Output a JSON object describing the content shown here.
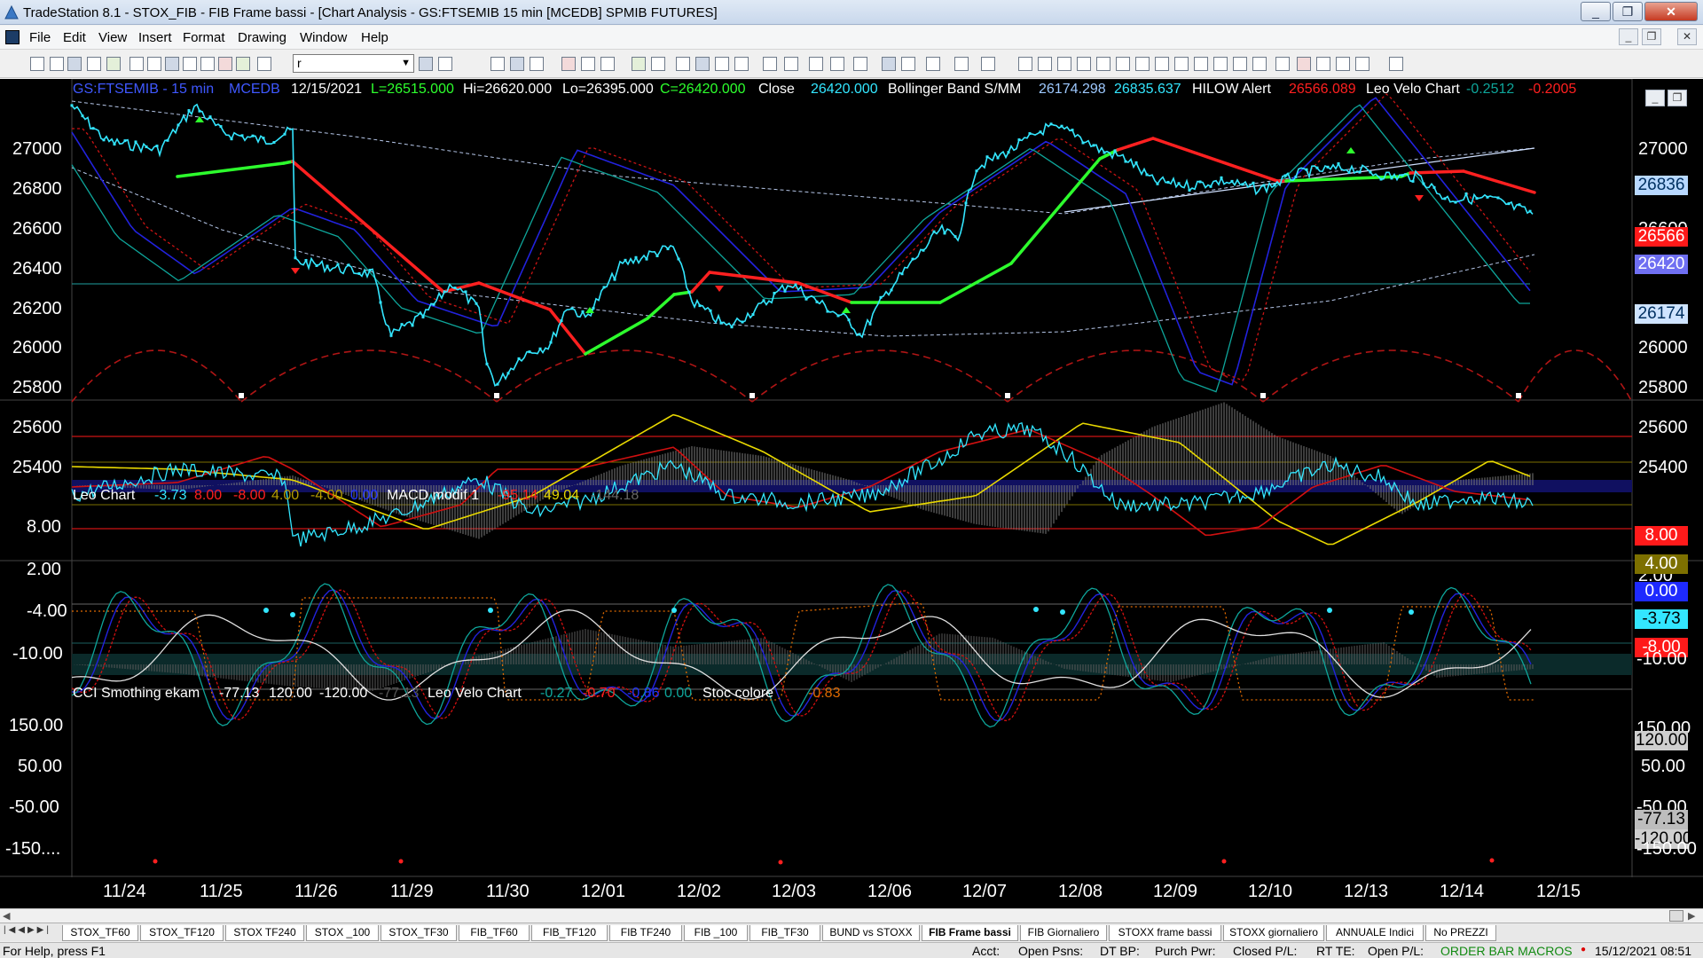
{
  "window": {
    "title": "TradeStation 8.1 - STOX_FIB - FIB Frame bassi - [Chart Analysis - GS:FTSEMIB  15 min  [MCEDB] SPMIB FUTURES]",
    "controls": [
      "_",
      "❐",
      "✕"
    ]
  },
  "menu": {
    "items": [
      "File",
      "Edit",
      "View",
      "Insert",
      "Format",
      "Drawing",
      "Window",
      "Help"
    ],
    "mdi_controls": [
      "_",
      "❐",
      "✕"
    ]
  },
  "toolbar": {
    "symbol_value": "r"
  },
  "colors": {
    "price": "#33e6ff",
    "up_band": "#2dff2d",
    "down_band": "#ff2020",
    "blue_osc": "#2222dd",
    "teal_osc": "#0ea59a",
    "yellow": "#e8d800",
    "gray_hist": "#7a7a7a"
  },
  "chart": {
    "header": {
      "symbol": "GS:FTSEMIB - 15 min",
      "source": "MCEDB",
      "date": "12/15/2021",
      "open": "L=26515.000",
      "high": "Hi=26620.000",
      "low": "Lo=26395.000",
      "close": "C=26420.000",
      "close_label": "Close",
      "close_value": "26420.000",
      "boll_label": "Bollinger Band S/MM",
      "boll_v1": "26174.298",
      "boll_v2": "26835.637",
      "hilow_label": "HILOW Alert",
      "hilow_value": "26566.089",
      "velo_label": "Leo Velo Chart",
      "velo_v1": "-0.2512",
      "velo_v2": "-0.2005"
    },
    "price_ticks": [
      "27000",
      "26800",
      "26600",
      "26400",
      "26200",
      "26000",
      "25800",
      "25600",
      "25400"
    ],
    "price_badges": {
      "b1": "26836",
      "b2": "26566",
      "b3": "26420",
      "b4": "26174"
    },
    "pane2": {
      "leo_label": "Leo Chart",
      "v1": "-3.73",
      "v2": "8.00",
      "v3": "-8.00",
      "v4": "4.00",
      "v5": "-4.00",
      "v6": "0.00",
      "macd_label": "MACD modif 1",
      "m1": "-95.14",
      "m2": "49.04",
      "m3": "-144.18",
      "ticks": [
        "8.00",
        "2.00",
        "-4.00",
        "-10.00"
      ],
      "badges": {
        "b1": "8.00",
        "b2": "4.00",
        "b3": "0.00",
        "b4": "-3.73",
        "b5": "-8.00",
        "b6": "2.00",
        "b7": "-10.00"
      }
    },
    "pane3": {
      "cci_label": "CCI Smothing ekam",
      "c1": "-77.13",
      "c2": "120.00",
      "c3": "-120.00",
      "c4": "-77.13",
      "velo_label": "Leo Velo Chart",
      "v1": "-0.27",
      "v2": "-0.70",
      "v3": "-0.86",
      "v4": "0.00",
      "stoc_label": "Stoc colore",
      "s1": "-0.83",
      "ticks": [
        "150.00",
        "50.00",
        "-50.00",
        "-150...."
      ],
      "badges": {
        "b1": "150.00",
        "b2": "120.00",
        "b3": "50.00",
        "b4": "-50.00",
        "b5": "-77.13",
        "b6": "-120.00",
        "b7": "-150.00"
      }
    },
    "x_labels": [
      "11/24",
      "11/25",
      "11/26",
      "11/29",
      "11/30",
      "12/01",
      "12/02",
      "12/03",
      "12/06",
      "12/07",
      "12/08",
      "12/09",
      "12/10",
      "12/13",
      "12/14",
      "12/15"
    ],
    "marker": "1"
  },
  "tabs": [
    "STOX_TF60",
    "STOX_TF120",
    "STOX TF240",
    "STOX _100",
    "STOX_TF30",
    "FIB_TF60",
    "FIB_TF120",
    "FIB TF240",
    "FIB _100",
    "FIB_TF30",
    "BUND vs STOXX",
    "FIB Frame bassi",
    "FIB Giornaliero",
    "STOXX frame bassi",
    "STOXX giornaliero",
    "ANNUALE Indici",
    "No PREZZI"
  ],
  "active_tab": "FIB Frame bassi",
  "status": {
    "help": "For Help, press F1",
    "acct": "Acct:",
    "open_psns": "Open Psns:",
    "dt_bp": "DT BP:",
    "purch_pwr": "Purch Pwr:",
    "closed_pl": "Closed P/L:",
    "rt_te": "RT TE:",
    "open_pl": "Open P/L:",
    "macros": "ORDER BAR  MACROS",
    "datetime": "15/12/2021 08:51"
  }
}
